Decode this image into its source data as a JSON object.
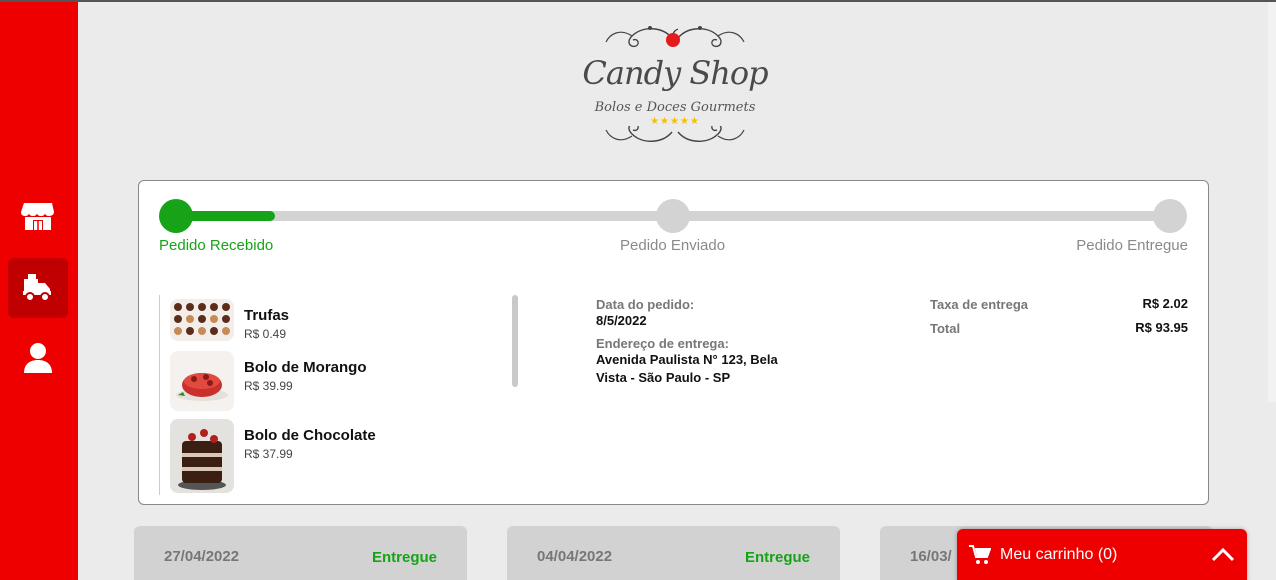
{
  "brand": {
    "name": "Candy Shop",
    "tagline": "Bolos e Doces Gourmets",
    "stars": "★★★★★"
  },
  "sidebar": {
    "items": [
      {
        "icon": "store-icon",
        "active": false
      },
      {
        "icon": "delivery-truck-icon",
        "active": true
      },
      {
        "icon": "user-icon",
        "active": false
      }
    ]
  },
  "order": {
    "progress_fraction": 0.1,
    "steps": [
      {
        "label": "Pedido Recebido",
        "done": true
      },
      {
        "label": "Pedido Enviado",
        "done": false
      },
      {
        "label": "Pedido Entregue",
        "done": false
      }
    ],
    "items": [
      {
        "name": "Trufas",
        "price": "R$ 0.49"
      },
      {
        "name": "Bolo de Morango",
        "price": "R$ 39.99"
      },
      {
        "name": "Bolo de Chocolate",
        "price": "R$ 37.99"
      }
    ],
    "date_label": "Data do pedido:",
    "date_value": "8/5/2022",
    "address_label": "Endereço de entrega:",
    "address_value": "Avenida Paulista N° 123, Bela Vista - São Paulo - SP",
    "fee_label": "Taxa de entrega",
    "fee_value": "R$ 2.02",
    "total_label": "Total",
    "total_value": "R$ 93.95"
  },
  "past_orders": [
    {
      "date": "27/04/2022",
      "status": "Entregue"
    },
    {
      "date": "04/04/2022",
      "status": "Entregue"
    },
    {
      "date": "16/03/",
      "status": ""
    }
  ],
  "cart": {
    "label": "Meu carrinho (0)"
  },
  "colors": {
    "sidebar": "#ee0000",
    "success": "#17a317",
    "track": "#d3d3d3"
  }
}
